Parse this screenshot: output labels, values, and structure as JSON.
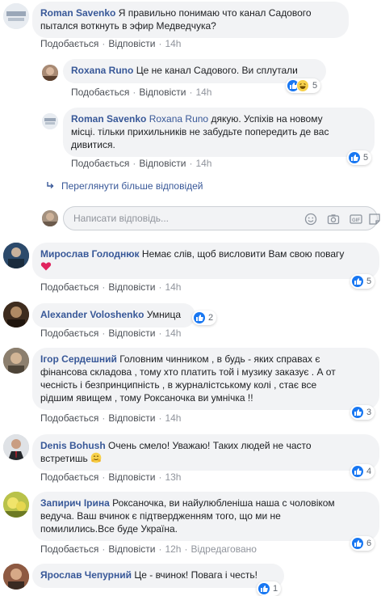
{
  "comments": [
    {
      "author": "Roman Savenko",
      "text": "Я правильно понимаю что канал Садового пытался воткнуть в эфир Медведчука?",
      "line1": "Я правильно понимаю что канал Садового",
      "line2": "пытался воткнуть в эфир Медведчука?",
      "like": "Подобається",
      "reply": "Відповісти",
      "time": "14h",
      "replies": [
        {
          "author": "Roxana Runo",
          "text": "Це не канал Садового. Ви сплутали",
          "like": "Подобається",
          "reply": "Відповісти",
          "time": "14h",
          "reactions": "5"
        },
        {
          "author": "Roman Savenko",
          "mention": "Roxana Runo",
          "line1": "дякую. Успіхів на новому",
          "line2": "місці. тільки прихильників не забудьте попередить де вас",
          "line3": "дивитися.",
          "like": "Подобається",
          "reply": "Відповісти",
          "time": "14h",
          "reactions": "5"
        }
      ],
      "more_replies": "Переглянути більше відповідей",
      "reply_placeholder": "Написати відповідь..."
    },
    {
      "author": "Мирослав Голоднюк",
      "line1": "Немає слів, щоб висловити Вам свою повагу",
      "like": "Подобається",
      "reply": "Відповісти",
      "time": "14h",
      "reactions": "5"
    },
    {
      "author": "Alexander Voloshenko",
      "text": "Умница",
      "like": "Подобається",
      "reply": "Відповісти",
      "time": "14h",
      "reactions": "2"
    },
    {
      "author": "Ігор Сердешний",
      "line1": "Головним чинником , в будь - яких справах є",
      "line2": "фінансова складова , тому хто платить той і музику заказує . А от",
      "line3": "чесність і безпринципність , в журналістському колі , стає все",
      "line4": "рідшим явищем , тому Роксаночка ви умнічка !!",
      "like": "Подобається",
      "reply": "Відповісти",
      "time": "14h",
      "reactions": "3"
    },
    {
      "author": "Denis Bohush",
      "line1": "Очень смело! Уважаю! Таких людей не часто",
      "line2": "встретишь",
      "like": "Подобається",
      "reply": "Відповісти",
      "time": "13h",
      "reactions": "4"
    },
    {
      "author": "Запирич Ірина",
      "line1": "Роксаночка, ви найулюбленіша наша с чоловіком",
      "line2": "ведуча. Ваш вчинок є підтвердженням того, що ми не",
      "line3": "помилились.Все буде Україна.",
      "like": "Подобається",
      "reply": "Відповісти",
      "time": "12h",
      "edited": "Відредаговано",
      "reactions": "6"
    },
    {
      "author": "Ярослав Чепурний",
      "text": "Це - вчинок! Повага і честь!",
      "reactions": "1"
    }
  ],
  "colors": {
    "link": "#385898",
    "bubble": "#f2f3f5",
    "like_blue": "#1877f2",
    "muted": "#90949c"
  },
  "icons": [
    "reply-arrow-icon",
    "smiley-icon",
    "camera-icon",
    "gif-icon",
    "sticker-icon",
    "like-icon",
    "haha-icon",
    "heart-icon",
    "hugging-face-icon"
  ]
}
